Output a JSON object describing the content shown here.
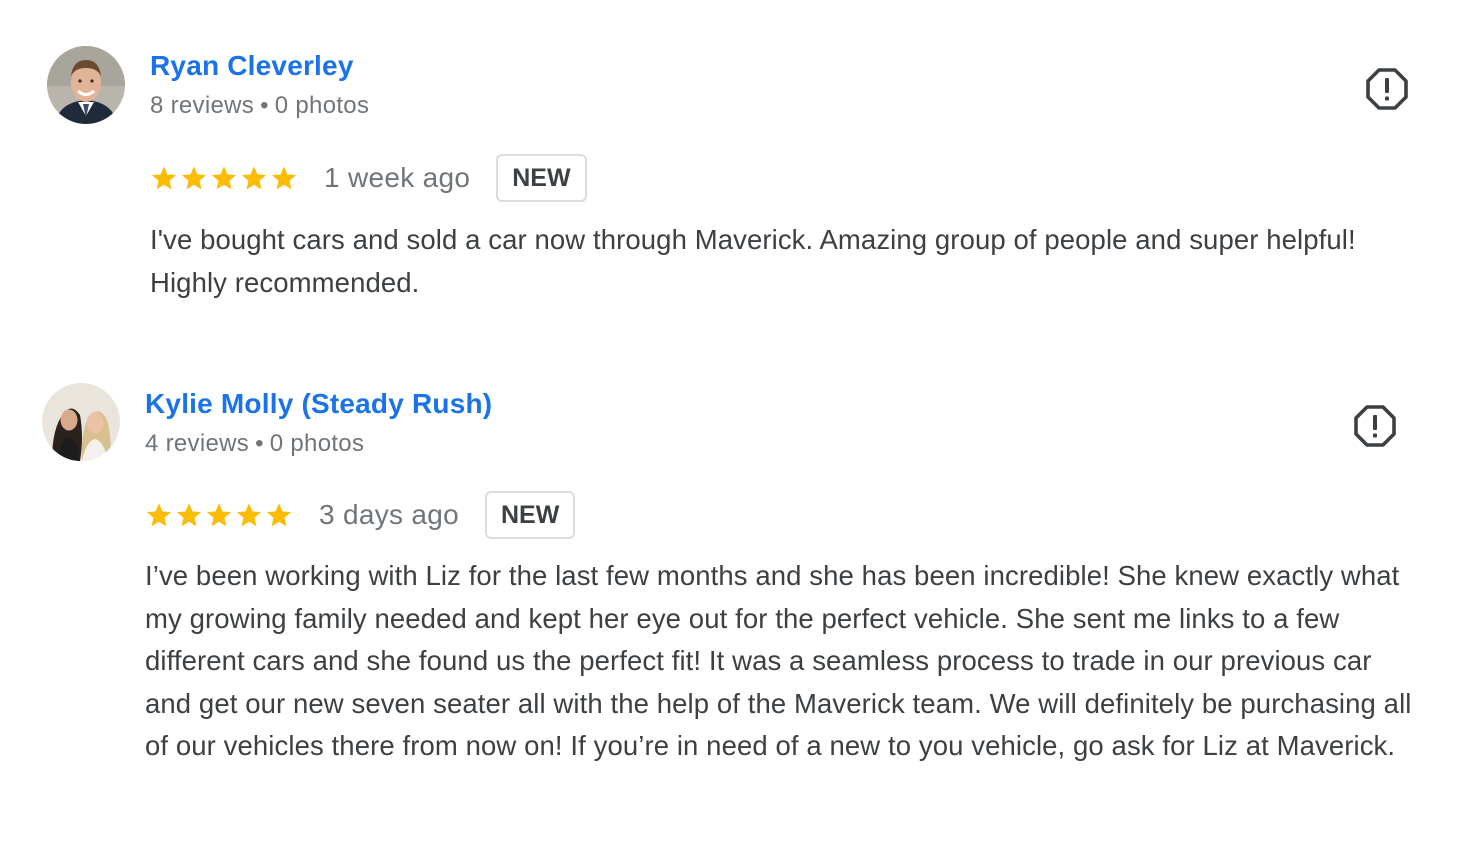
{
  "reviews": [
    {
      "author": "Ryan Cleverley",
      "reviews_count": "8 reviews",
      "separator": "•",
      "photos_count": "0 photos",
      "rating": 5,
      "time": "1 week ago",
      "badge": "NEW",
      "text": "I've bought cars and sold a car now through Maverick. Amazing group of people and super helpful! Highly recommended."
    },
    {
      "author": "Kylie Molly (Steady Rush)",
      "reviews_count": "4 reviews",
      "separator": "•",
      "photos_count": "0 photos",
      "rating": 5,
      "time": "3 days ago",
      "badge": "NEW",
      "text": "I’ve been working with Liz for the last few months and she has been incredible! She knew exactly what my growing family needed and kept her eye out for the perfect vehicle. She sent me links to a few different cars and she found us the perfect fit! It was a seamless process to trade in our previous car and get our new seven seater all with the help of the Maverick team. We will definitely be purchasing all of our vehicles there from now on! If you’re in need of a new to you vehicle, go ask for Liz at Maverick."
    }
  ],
  "colors": {
    "author_link": "#1a73e8",
    "star": "#fbbc04",
    "meta_text": "#70757a",
    "body_text": "#3c4043",
    "badge_border": "#dadce0"
  },
  "icons": {
    "flag": "report-flag-icon",
    "star": "star-icon"
  }
}
